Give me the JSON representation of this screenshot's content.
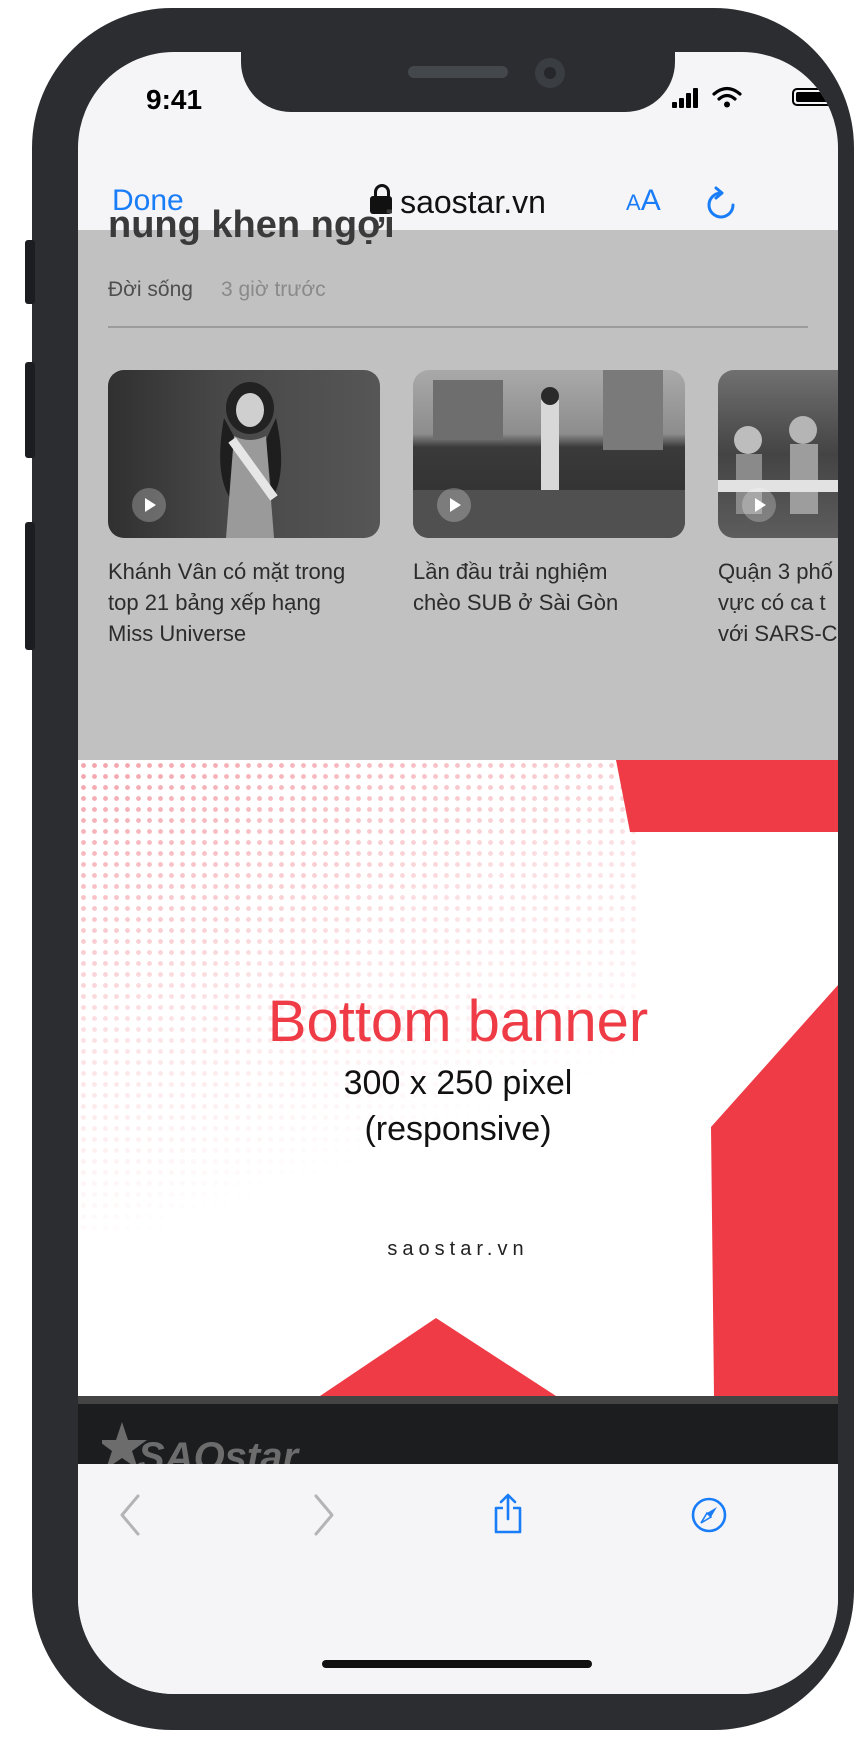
{
  "status_bar": {
    "time": "9:41"
  },
  "browser": {
    "done_label": "Done",
    "url": "saostar.vn",
    "text_size_small": "A",
    "text_size_large": "A"
  },
  "article": {
    "cut_title": "nung khen ngợi",
    "category": "Đời sống",
    "time": "3 giờ trước"
  },
  "related": [
    {
      "line1": "Khánh Vân có mặt trong",
      "line2": "top 21 bảng xếp hạng",
      "line3": "Miss Universe"
    },
    {
      "line1": "Lần đầu trải nghiệm",
      "line2": "chèo SUB ở Sài Gòn",
      "line3": ""
    },
    {
      "line1": "Quận 3 phố",
      "line2": "vực có ca t",
      "line3": "với SARS-C"
    }
  ],
  "banner": {
    "title": "Bottom banner",
    "size": "300 x 250 pixel",
    "note": "(responsive)",
    "site": "saostar.vn",
    "accent_color": "#ee3b46"
  },
  "footer": {
    "logo": "SAOstar"
  },
  "toolbar": {
    "back_icon": "chevron-left-icon",
    "forward_icon": "chevron-right-icon",
    "share_icon": "share-icon",
    "compass_icon": "compass-icon"
  }
}
